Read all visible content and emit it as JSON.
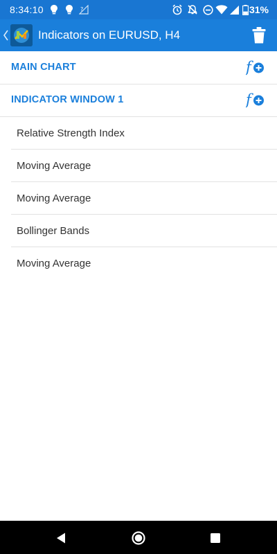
{
  "status_bar": {
    "time": "8:34:10",
    "battery_percent": "31%"
  },
  "app_bar": {
    "title": "Indicators on EURUSD, H4"
  },
  "sections": [
    {
      "label": "MAIN CHART"
    },
    {
      "label": "INDICATOR WINDOW 1"
    }
  ],
  "indicators": [
    {
      "name": "Relative Strength Index"
    },
    {
      "name": "Moving Average"
    },
    {
      "name": "Moving Average"
    },
    {
      "name": "Bollinger Bands"
    },
    {
      "name": "Moving Average"
    }
  ],
  "icons": {
    "back": "chevron-left-icon",
    "trash": "trash-icon",
    "add_function": "function-add-icon",
    "nav_back": "triangle-back-icon",
    "nav_home": "circle-home-icon",
    "nav_recents": "square-recents-icon"
  },
  "colors": {
    "accent": "#1a7fdb",
    "status_bar": "#1976d2",
    "text": "#333333",
    "divider": "#e2e2e2"
  }
}
